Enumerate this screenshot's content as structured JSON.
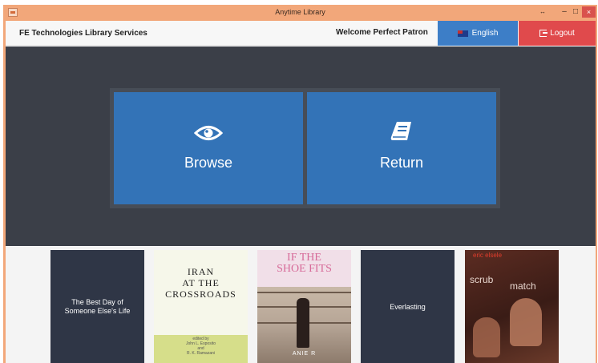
{
  "window": {
    "title": "Anytime Library",
    "controls": {
      "restore": "↔",
      "minimize": "–",
      "maximize": "□",
      "close": "×"
    }
  },
  "header": {
    "org_name": "FE Technologies Library Services",
    "welcome": "Welcome Perfect Patron",
    "language_label": "English",
    "logout_label": "Logout"
  },
  "actions": {
    "browse": {
      "label": "Browse",
      "icon": "eye-icon"
    },
    "return": {
      "label": "Return",
      "icon": "book-icon"
    }
  },
  "books": [
    {
      "title_lines": [
        "The Best Day of",
        "Someone Else's Life"
      ],
      "cover": "#2f3646"
    },
    {
      "title_lines": [
        "IRAN",
        "AT THE",
        "CROSSROADS"
      ],
      "credit_lines": [
        "edited by",
        "John L. Esposito",
        "and",
        "R. K. Ramazani"
      ],
      "cover": "#f6f7ea",
      "band": "#d6de8a"
    },
    {
      "title_lines": [
        "IF THE",
        "SHOE FITS"
      ],
      "author_fragment": "ANIE R",
      "cover": "#f1dfe8",
      "accent": "#d76b99"
    },
    {
      "title_lines": [
        "Everlasting"
      ],
      "cover": "#2f3646"
    },
    {
      "title_words": [
        "scrub",
        "match"
      ],
      "author": "eric elsele",
      "cover": "#4a241c",
      "accent": "#e03d2c"
    }
  ],
  "colors": {
    "titlebar": "#f2a77a",
    "hero_bg": "#3b3f48",
    "tile_blue": "#3373b7",
    "language_blue": "#3d7ec7",
    "logout_red": "#e04a4c"
  }
}
